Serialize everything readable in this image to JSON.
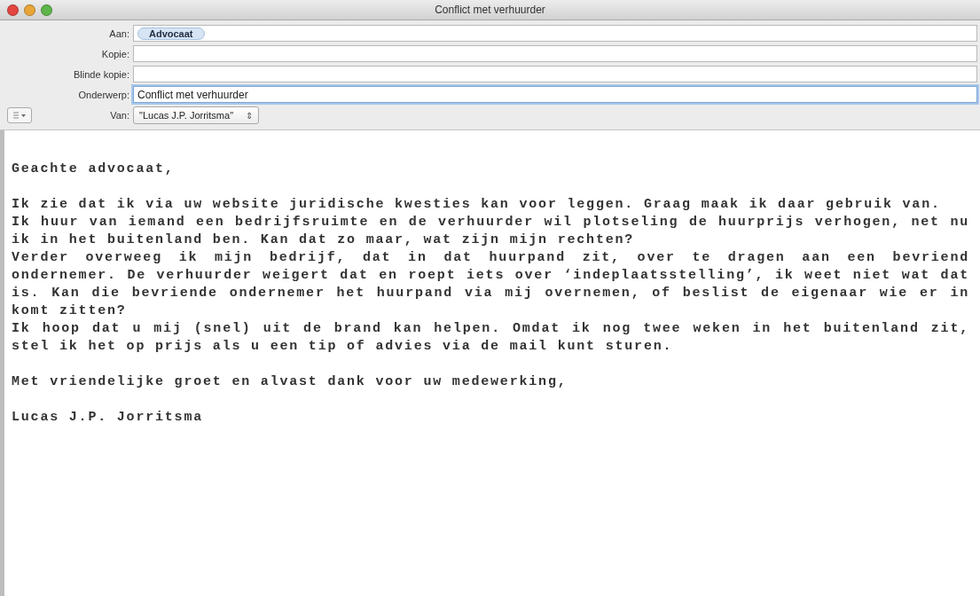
{
  "window": {
    "title": "Conflict met verhuurder"
  },
  "fields": [
    {
      "label": "Aan:",
      "kind": "recipients",
      "tokens": [
        "Advocaat"
      ],
      "focused": false
    },
    {
      "label": "Kopie:",
      "kind": "text",
      "focused": false
    },
    {
      "label": "Blinde kopie:",
      "kind": "text",
      "focused": false
    },
    {
      "label": "Onderwerp:",
      "kind": "text",
      "value": "Conflict met verhuurder",
      "focused": true
    }
  ],
  "from": {
    "label": "Van:",
    "value": "\"Lucas J.P. Jorritsma\"",
    "popup_arrows": "⇕"
  },
  "body": {
    "greeting": "Geachte advocaat,",
    "paragraphs": [
      "Ik zie dat ik via uw website juridische kwesties kan voor leggen. Graag maak ik daar gebruik van.",
      "Ik huur van iemand een bedrijfsruimte en de verhuurder wil plotseling de huurprijs verhogen, net nu ik in het buitenland ben. Kan dat zo maar, wat zijn mijn rechten?",
      "Verder overweeg ik mijn bedrijf, dat in dat huurpand zit, over te dragen aan een bevriend ondernemer. De verhuurder weigert dat en roept iets over ‘indeplaatsstelling’, ik weet niet wat dat is. Kan die bevriende ondernemer het huurpand via mij overnemen, of beslist de eigenaar wie er in komt zitten?",
      "Ik hoop dat u mij (snel) uit de brand kan helpen. Omdat ik nog twee weken in het buitenland zit, stel ik het op prijs als u een tip of advies via de mail kunt sturen."
    ],
    "closing": "Met vriendelijke groet en alvast dank voor uw medewerking,",
    "signature": "Lucas J.P. Jorritsma"
  }
}
